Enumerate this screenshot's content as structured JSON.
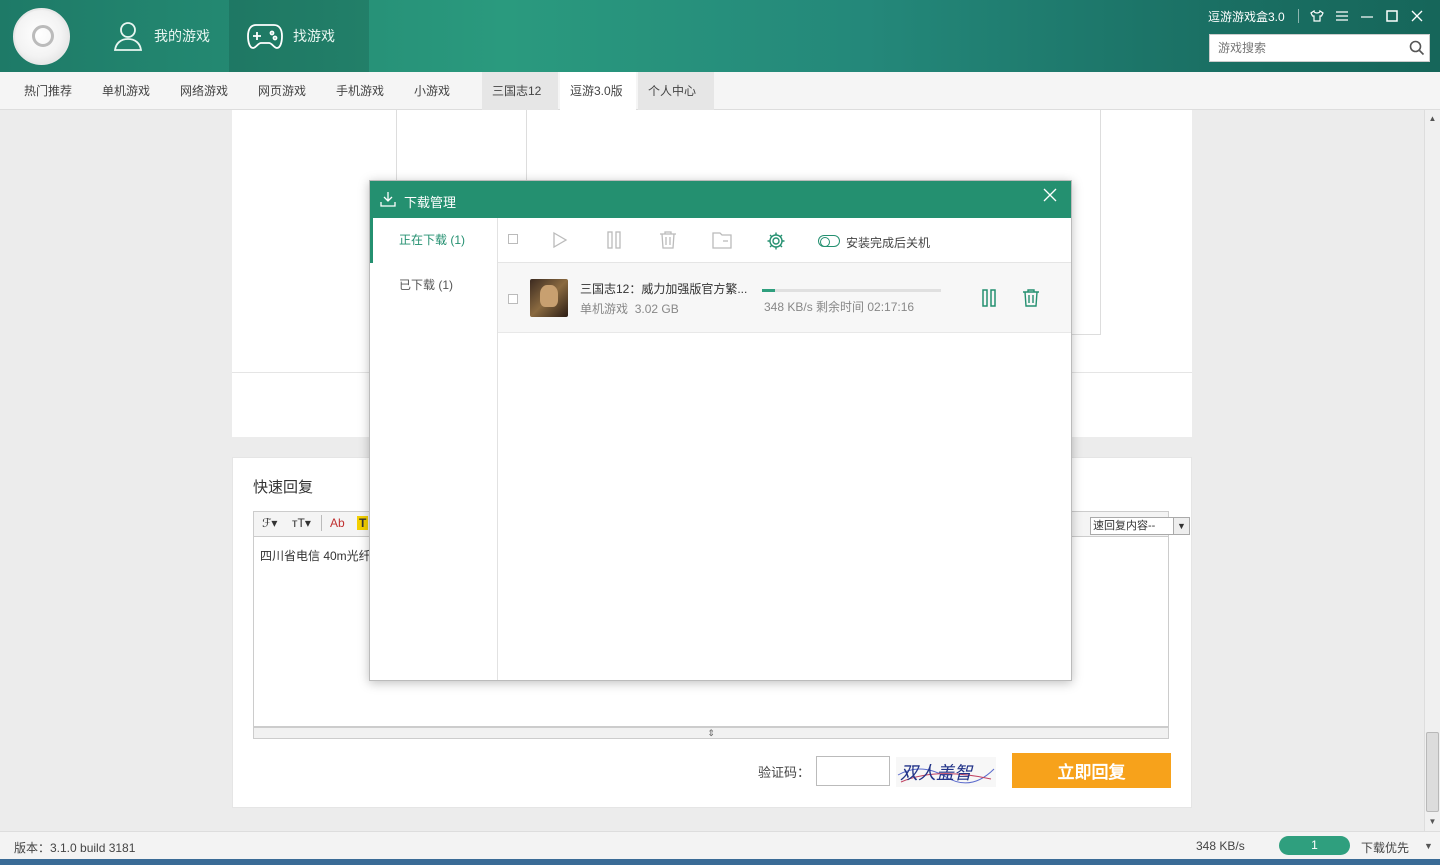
{
  "header": {
    "app_title": "逗游游戏盒3.0",
    "tabs": [
      {
        "label": "我的游戏"
      },
      {
        "label": "找游戏"
      }
    ],
    "search_placeholder": "游戏搜索"
  },
  "subnav": {
    "items": [
      "热门推荐",
      "单机游戏",
      "网络游戏",
      "网页游戏",
      "手机游戏",
      "小游戏",
      "三国志12",
      "逗游3.0版",
      "个人中心"
    ],
    "active": "逗游3.0版"
  },
  "reply": {
    "title": "快速回复",
    "toolbar": {
      "font": "ℱ▾",
      "size": "ᴛT▾",
      "color": "Ab",
      "highlight": "T"
    },
    "quick_select": "速回复内容--",
    "body_text": "四川省电信 40m光纤",
    "captcha_label": "验证码：",
    "captcha_text": "双人盖智",
    "submit_label": "立即回复"
  },
  "dialog": {
    "title": "下载管理",
    "side": [
      {
        "label": "正在下载 (1)"
      },
      {
        "label": "已下载 (1)"
      }
    ],
    "shutdown_label": "安装完成后关机",
    "item": {
      "name": "三国志12：威力加强版官方繁...",
      "category": "单机游戏",
      "size": "3.02 GB",
      "status": "348 KB/s  剩余时间 02:17:16",
      "progress_percent": 7
    },
    "accent": "#249070"
  },
  "statusbar": {
    "version": "版本：3.1.0 build 3181",
    "speed": "348 KB/s",
    "download_count": "1",
    "priority": "下载优先"
  }
}
